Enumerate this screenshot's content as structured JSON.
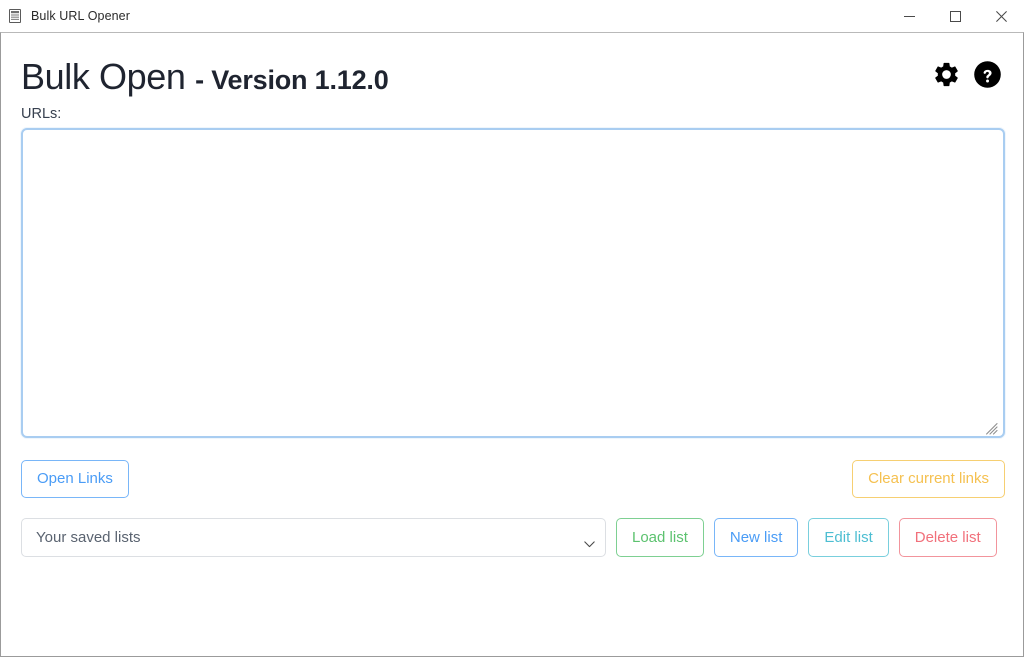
{
  "window": {
    "titlebar": {
      "icon": "document-list-icon",
      "title": "Bulk URL Opener",
      "minimize_label": "Minimize",
      "maximize_label": "Maximize",
      "close_label": "Close"
    }
  },
  "header": {
    "app_name": "Bulk Open",
    "version_text": "- Version 1.12.0",
    "settings_icon": "gear-icon",
    "help_icon": "question-circle-icon"
  },
  "urls_section": {
    "label": "URLs:",
    "value": "",
    "placeholder": "",
    "resize_handle": "resize-grip-icon"
  },
  "actions": {
    "open_links_label": "Open Links",
    "clear_links_label": "Clear current links"
  },
  "lists": {
    "select_value": "Your saved lists",
    "options": [
      "Your saved lists"
    ],
    "chevron_icon": "chevron-down-icon",
    "load_label": "Load list",
    "new_label": "New list",
    "edit_label": "Edit list",
    "delete_label": "Delete list"
  },
  "colors": {
    "primary": "#4a9cf6",
    "warning": "#f5c151",
    "success": "#5cc26f",
    "info": "#4dbed2",
    "danger": "#f1707b",
    "textarea_border": "#a9cdf1",
    "window_border": "#9b9b9b"
  }
}
